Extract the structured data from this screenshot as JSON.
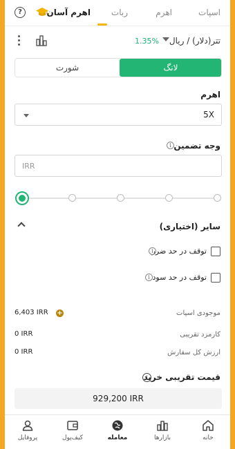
{
  "tabs": [
    {
      "label": "اسپات",
      "active": false
    },
    {
      "label": "اهرم",
      "active": false
    },
    {
      "label": "ربات",
      "active": false
    },
    {
      "label": "اهرم آسان",
      "active": true
    }
  ],
  "pair": {
    "title": "تتر(دلار) / ریال",
    "change": "1.35%",
    "change_color": "#1db073"
  },
  "side_toggle": {
    "long_label": "لانگ",
    "short_label": "شورت",
    "selected": "long",
    "long_color": "#22b573"
  },
  "leverage": {
    "label": "اهرم",
    "value": "5X"
  },
  "margin": {
    "label": "وجه تضمین",
    "placeholder": "IRR",
    "value": ""
  },
  "slider": {
    "level": 0,
    "stops": 6
  },
  "other": {
    "label": "سایر (اختیاری)",
    "expanded": true,
    "stop_loss_label": "توقف در حد ضرر",
    "take_profit_label": "توقف در حد سود"
  },
  "summary": {
    "spot_balance_label": "موجودی اسپات",
    "spot_balance_value": "6,403 IRR",
    "fee_label": "کارمزد تقریبی",
    "fee_value": "0 IRR",
    "total_label": "ارزش کل سفارش",
    "total_value": "0 IRR"
  },
  "estimated_price": {
    "label": "قیمت تقریبی خرید",
    "value": "929,200 IRR"
  },
  "bottom_nav": [
    {
      "label": "خانه",
      "icon": "home-icon",
      "active": false
    },
    {
      "label": "بازارها",
      "icon": "markets-icon",
      "active": false
    },
    {
      "label": "معامله",
      "icon": "trade-icon",
      "active": true
    },
    {
      "label": "کیف‌پول",
      "icon": "wallet-icon",
      "active": false
    },
    {
      "label": "پروفایل",
      "icon": "profile-icon",
      "active": false
    }
  ],
  "colors": {
    "accent": "#f5b400",
    "frame": "#f5a623",
    "positive": "#22b573"
  }
}
